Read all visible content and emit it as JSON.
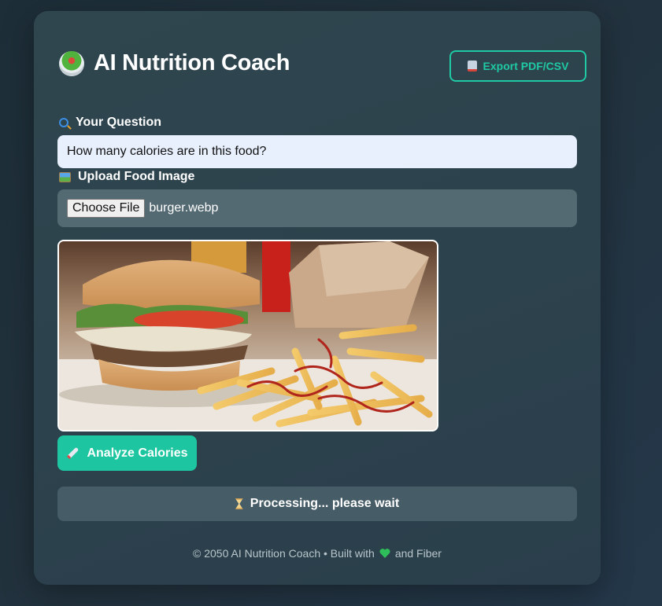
{
  "app": {
    "title": "AI Nutrition Coach",
    "logo_icon": "salad-bowl-icon",
    "accent_color": "#1dc6a0"
  },
  "toolbar": {
    "export_label": "Export PDF/CSV",
    "export_icon": "inbox-tray-icon"
  },
  "question": {
    "label": "Your Question",
    "icon": "magnifier-icon",
    "value": "How many calories are in this food?"
  },
  "upload": {
    "label": "Upload Food Image",
    "icon": "framed-picture-icon",
    "button_label": "Choose File",
    "file_name": "burger.webp"
  },
  "preview": {
    "icon": "food-photo-burger-fries"
  },
  "actions": {
    "analyze_label": "Analyze Calories",
    "analyze_icon": "rocket-icon"
  },
  "status": {
    "text": "Processing... please wait",
    "icon": "hourglass-icon"
  },
  "footer": {
    "prefix": "© 2050 AI Nutrition Coach • Built with",
    "suffix": "and Fiber",
    "heart_icon": "green-heart-icon",
    "heart_color": "#2fbf5a"
  }
}
